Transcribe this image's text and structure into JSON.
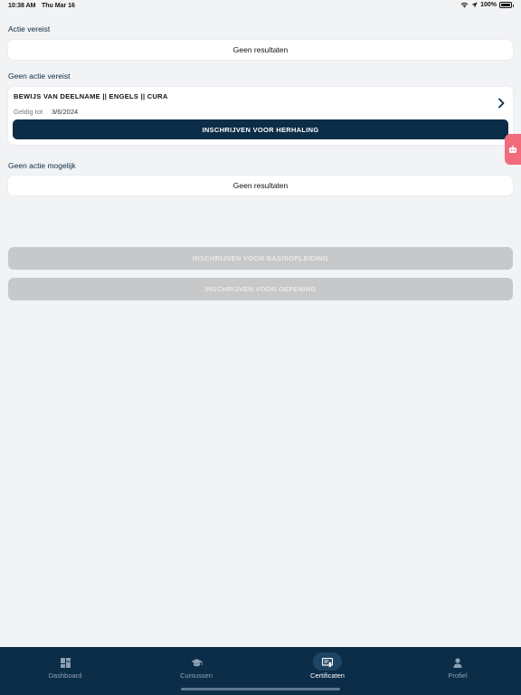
{
  "status_bar": {
    "time": "10:38 AM",
    "date": "Thu Mar 16",
    "battery": "100%",
    "battery_level": 1.0
  },
  "sections": {
    "action_required": {
      "label": "Actie vereist",
      "empty_text": "Geen resultaten"
    },
    "no_action_required": {
      "label": "Geen actie vereist",
      "certificate": {
        "title": "BEWIJS VAN DEELNAME || ENGELS || CURA",
        "valid_label": "Geldig tot",
        "valid_value": "3/6/2024",
        "renew_button": "INSCHRIJVEN VOOR HERHALING"
      }
    },
    "no_action_possible": {
      "label": "Geen actie mogelijk",
      "empty_text": "Geen resultaten"
    }
  },
  "buttons": {
    "basic_training": "INSCHRIJVEN VOOR BASISOPLEIDING",
    "exercise": "INSCHRIJVEN VOOR OEFENING"
  },
  "tab_bar": {
    "active": "Certificaten",
    "tabs": [
      {
        "label": "Dashboard",
        "icon": "dashboard-icon"
      },
      {
        "label": "Cursussen",
        "icon": "graduation-cap-icon"
      },
      {
        "label": "Certificaten",
        "icon": "certificate-icon"
      },
      {
        "label": "Profiel",
        "icon": "person-icon"
      }
    ]
  },
  "colors": {
    "primary": "#0b2d48",
    "background": "#f2f3f5",
    "disabled": "#c7c8ca",
    "side_tab": "#f06b7b"
  }
}
